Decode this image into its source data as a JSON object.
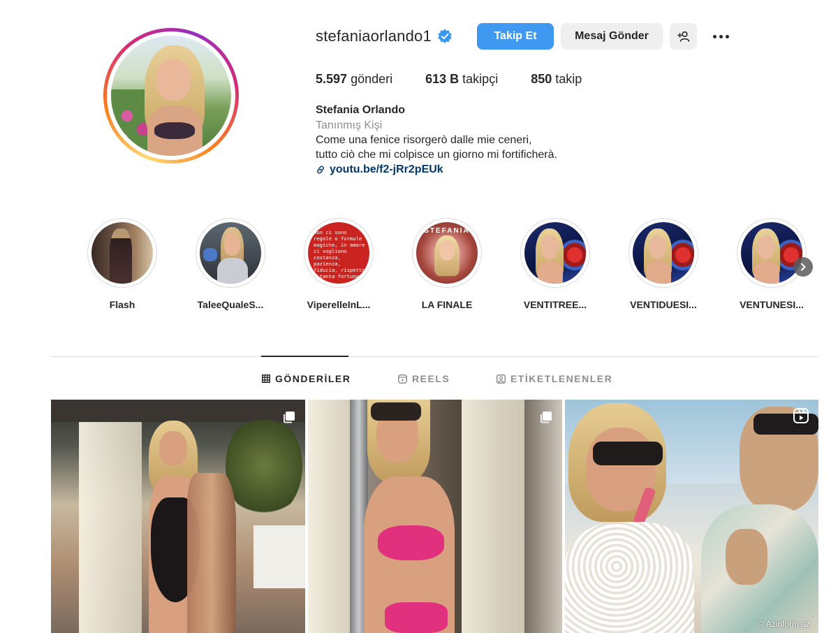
{
  "profile": {
    "username": "stefaniaorlando1",
    "verified": true,
    "follow_label": "Takip Et",
    "message_label": "Mesaj Gönder",
    "adduser_icon": "add-user-icon",
    "more_icon": "more-options-icon",
    "stats": {
      "posts_value": "5.597",
      "posts_label": "gönderi",
      "followers_value": "613 B",
      "followers_label": "takipçi",
      "following_value": "850",
      "following_label": "takip"
    },
    "full_name": "Stefania Orlando",
    "category": "Tanınmış Kişi",
    "bio_line1": "Come una fenice risorgerò dalle mie ceneri,",
    "bio_line2": "tutto ciò che mi colpisce un giorno mi fortificherà.",
    "link_text": "youtu.be/f2-jRr2pEUk"
  },
  "highlights": [
    {
      "label": "Flash"
    },
    {
      "label": "TaleeQualeS..."
    },
    {
      "label": "ViperelleInL...",
      "cover_text": "Non ci sono regole o formule magiche, in amore ci vogliono costanza, pazienza, fiducia, rispetto e tanta fortuna!"
    },
    {
      "label": "LA FINALE",
      "cover_title": "STEFANIA"
    },
    {
      "label": "VENTITREE..."
    },
    {
      "label": "VENTIDUESI..."
    },
    {
      "label": "VENTUNESI..."
    }
  ],
  "tabs": [
    {
      "label": "GÖNDERİLER",
      "icon": "grid-icon",
      "active": true
    },
    {
      "label": "REELS",
      "icon": "reels-icon",
      "active": false
    },
    {
      "label": "ETİKETLENENLER",
      "icon": "tagged-icon",
      "active": false
    }
  ],
  "posts": [
    {
      "type": "carousel",
      "icon": "multiple-posts-icon"
    },
    {
      "type": "carousel",
      "icon": "multiple-posts-icon"
    },
    {
      "type": "reel",
      "icon": "reel-icon"
    }
  ],
  "watermark": "© Azinform.az",
  "colors": {
    "primary_button": "#3f99f0",
    "verified_badge": "#3897f0",
    "link": "#00376b",
    "secondary_text": "#8e8e8e"
  }
}
